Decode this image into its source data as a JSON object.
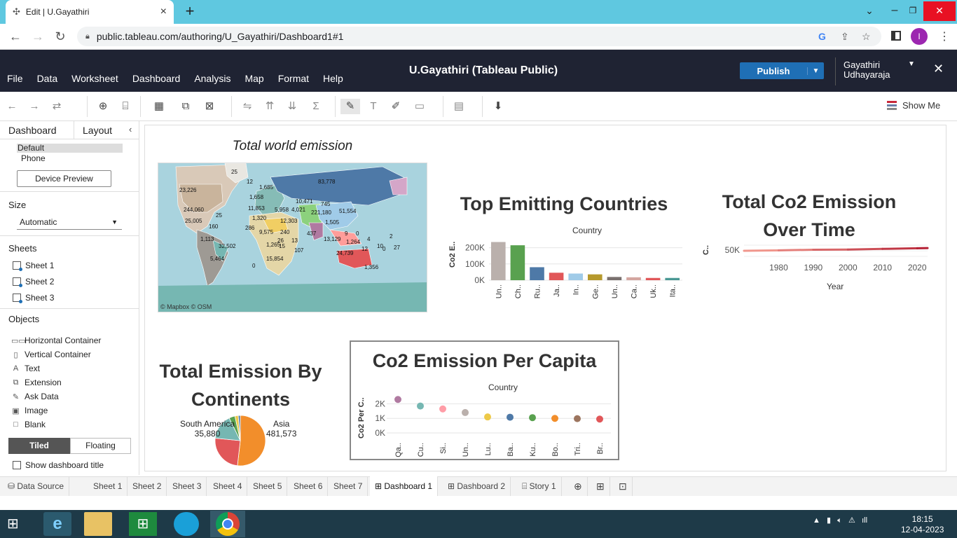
{
  "browser": {
    "tab_title": "Edit | U.Gayathiri",
    "url": "public.tableau.com/authoring/U_Gayathiri/Dashboard1#1",
    "profile_initial": "I"
  },
  "tableau": {
    "menu": [
      "File",
      "Data",
      "Worksheet",
      "Dashboard",
      "Analysis",
      "Map",
      "Format",
      "Help"
    ],
    "workbook_title": "U.Gayathiri (Tableau Public)",
    "publish_label": "Publish",
    "user_line1": "Gayathiri",
    "user_line2": "Udhayaraja",
    "show_me": "Show Me"
  },
  "left_pane": {
    "tab_dashboard": "Dashboard",
    "tab_layout": "Layout",
    "device_default": "Default",
    "device_phone": "Phone",
    "device_preview": "Device Preview",
    "size_heading": "Size",
    "size_value": "Automatic",
    "sheets_heading": "Sheets",
    "sheets": [
      "Sheet 1",
      "Sheet 2",
      "Sheet 3"
    ],
    "objects_heading": "Objects",
    "objects": [
      "Horizontal Container",
      "Vertical Container",
      "Text",
      "Extension",
      "Ask Data",
      "Image",
      "Blank"
    ],
    "tiled": "Tiled",
    "floating": "Floating",
    "show_title": "Show dashboard title"
  },
  "dashboard": {
    "map_title": "Total world emission",
    "map_attribution": "© Mapbox  © OSM",
    "map_labels": [
      "25",
      "12",
      "23,226",
      "1,685",
      "83,778",
      "244,060",
      "1,658",
      "10,471",
      "745",
      "11,853",
      "5,958",
      "4,021",
      "221,180",
      "51,554",
      "25",
      "1,320",
      "1,505",
      "25,005",
      "12,303",
      "160",
      "286",
      "9,575",
      "240",
      "437",
      "9",
      "0",
      "13,129",
      "4",
      "1,113",
      "13",
      "15",
      "32,502",
      "1,264",
      "10",
      "2",
      "26",
      "5,464",
      "1,265",
      "107",
      "12",
      "27",
      "0",
      "15,854",
      "24,739",
      "1,356",
      "0"
    ],
    "bar_title": "Top Emitting Countries",
    "bar_axis_title": "Country",
    "bar_ylabel": "Co2 E..",
    "line_title_1": "Total Co2 Emission",
    "line_title_2": "Over Time",
    "line_xlabel": "Year",
    "line_ylabel": "C..",
    "pie_title_1": "Total Emission By",
    "pie_title_2": "Continents",
    "pie_label_sa": "South America",
    "pie_value_sa": "35,880",
    "pie_label_asia": "Asia",
    "pie_value_asia": "481,573",
    "scatter_title": "Co2 Emission Per Capita",
    "scatter_axis_title": "Country",
    "scatter_ylabel": "Co2 Per C.."
  },
  "bottom_tabs": [
    "Data Source",
    "Sheet 1",
    "Sheet 2",
    "Sheet 3",
    "Sheet 4",
    "Sheet 5",
    "Sheet 6",
    "Sheet 7",
    "Dashboard 1",
    "Dashboard 2",
    "Story 1"
  ],
  "taskbar": {
    "time": "18:15",
    "date": "12-04-2023"
  },
  "chart_data": [
    {
      "type": "bar",
      "title": "Top Emitting Countries",
      "xlabel": "Country",
      "ylabel": "Co2 E..",
      "categories": [
        "Un..",
        "Ch..",
        "Ru..",
        "Ja..",
        "In..",
        "Ge..",
        "Un..",
        "Ca..",
        "Uk..",
        "Ita.."
      ],
      "values": [
        235000,
        215000,
        80000,
        46000,
        41000,
        36000,
        20000,
        18000,
        14000,
        14000
      ],
      "colors": [
        "#bab0ac",
        "#59a14f",
        "#4e79a7",
        "#e15759",
        "#a0cbe8",
        "#b6992d",
        "#79706e",
        "#d4a6a0",
        "#e15759",
        "#499894"
      ],
      "yticks": [
        "0K",
        "100K",
        "200K"
      ],
      "ylim": [
        0,
        250000
      ]
    },
    {
      "type": "line",
      "title": "Total Co2 Emission Over Time",
      "xlabel": "Year",
      "ylabel": "C..",
      "x": [
        1970,
        1980,
        1990,
        2000,
        2010,
        2020,
        2023
      ],
      "y": [
        50000,
        51000,
        52500,
        53000,
        54500,
        56000,
        56500
      ],
      "xticks": [
        "1980",
        "1990",
        "2000",
        "2010",
        "2020"
      ],
      "yticks": [
        "50K"
      ]
    },
    {
      "type": "pie",
      "title": "Total Emission By Continents",
      "labels": [
        "Asia",
        "",
        "",
        "South America",
        "",
        ""
      ],
      "values": [
        481573,
        230000,
        150000,
        35880,
        20000,
        12000
      ],
      "colors": [
        "#f28e2b",
        "#e15759",
        "#76b7b2",
        "#59a14f",
        "#edc948",
        "#4e79a7"
      ]
    },
    {
      "type": "scatter",
      "title": "Co2 Emission Per Capita",
      "xlabel": "Country",
      "ylabel": "Co2 Per C..",
      "categories": [
        "Qa..",
        "Cu..",
        "Si..",
        "Un..",
        "Lu..",
        "Ba..",
        "Ku..",
        "Bo..",
        "Tri..",
        "Br.."
      ],
      "values": [
        2300,
        1850,
        1650,
        1400,
        1100,
        1080,
        1050,
        1000,
        980,
        950
      ],
      "colors": [
        "#b07aa1",
        "#76b7b2",
        "#ff9da7",
        "#bab0ac",
        "#edc948",
        "#4e79a7",
        "#59a14f",
        "#f28e2b",
        "#9c755f",
        "#e15759"
      ],
      "yticks": [
        "0K",
        "1K",
        "2K"
      ],
      "ylim": [
        0,
        2600
      ]
    }
  ]
}
